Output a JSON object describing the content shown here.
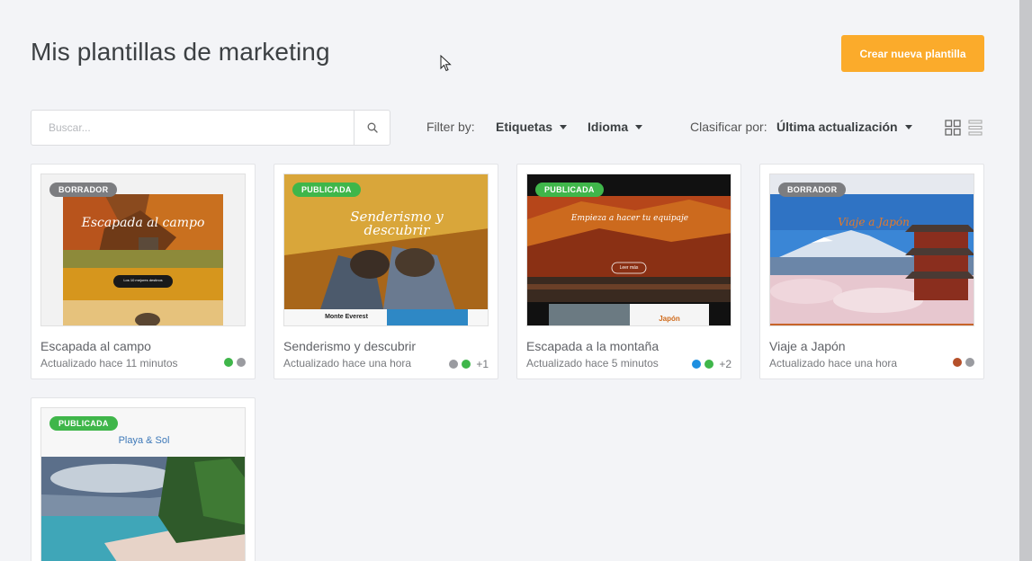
{
  "page": {
    "title": "Mis plantillas de marketing",
    "create_button": "Crear nueva plantilla"
  },
  "toolbar": {
    "search_placeholder": "Buscar...",
    "filter_label": "Filter by:",
    "filter_tags": "Etiquetas",
    "filter_language": "Idioma",
    "sort_label": "Clasificar por:",
    "sort_value": "Última actualización",
    "search_icon": "search-icon",
    "grid_view_icon": "grid-view-icon",
    "list_view_icon": "list-view-icon"
  },
  "colors": {
    "accent": "#fbab2b",
    "draft": "#7c7d80",
    "published": "#3fb64a"
  },
  "templates": [
    {
      "name": "Escapada al campo",
      "updated": "Actualizado hace 11 minutos",
      "status": "BORRADOR",
      "thumb_title": "Escapada al campo",
      "thumb_button": "Los 10 mejores destinos",
      "tags": [
        "#3fb64a",
        "#9a9ba0"
      ],
      "more": ""
    },
    {
      "name": "Senderismo y descubrir",
      "updated": "Actualizado hace una hora",
      "status": "PUBLICADA",
      "thumb_title": "Senderismo y descubrir",
      "thumb_caption": "Monte Everest",
      "tags": [
        "#9a9ba0",
        "#3fb64a"
      ],
      "more": "+1"
    },
    {
      "name": "Escapada a la montaña",
      "updated": "Actualizado hace 5 minutos",
      "status": "PUBLICADA",
      "thumb_title": "Empieza a hacer tu equipaje",
      "thumb_button": "Leer más",
      "thumb_caption": "Japón",
      "tags": [
        "#1e8fe0",
        "#3fb64a"
      ],
      "more": "+2"
    },
    {
      "name": "Viaje a Japón",
      "updated": "Actualizado hace una hora",
      "status": "BORRADOR",
      "thumb_title": "Viaje a Japón",
      "tags": [
        "#b5502a",
        "#9a9ba0"
      ],
      "more": ""
    },
    {
      "name": "",
      "updated": "",
      "status": "PUBLICADA",
      "thumb_title": "Playa & Sol",
      "tags": [],
      "more": ""
    }
  ]
}
